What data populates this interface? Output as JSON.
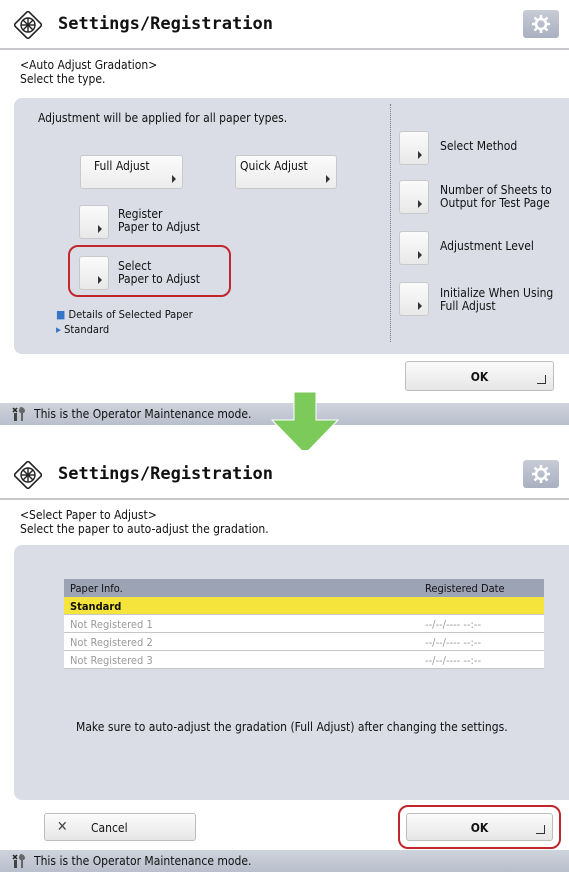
{
  "top": {
    "title": "Settings/Registration",
    "subheading_1": "<Auto Adjust Gradation>",
    "subheading_2": "Select the type.",
    "info": "Adjustment will be applied for all paper types.",
    "full_adjust": "Full Adjust",
    "quick_adjust": "Quick Adjust",
    "register_paper_1": "Register",
    "register_paper_2": "Paper to Adjust",
    "select_paper_1": "Select",
    "select_paper_2": "Paper to Adjust",
    "details_label": "Details of Selected Paper",
    "details_value": "Standard",
    "right_options": [
      {
        "line1": "Select Method",
        "line2": ""
      },
      {
        "line1": "Number of Sheets to",
        "line2": "Output for Test Page"
      },
      {
        "line1": "Adjustment Level",
        "line2": ""
      },
      {
        "line1": "Initialize When Using",
        "line2": "Full Adjust"
      }
    ],
    "ok": "OK",
    "footer": "This is the Operator Maintenance mode."
  },
  "bottom": {
    "title": "Settings/Registration",
    "subheading_1": "<Select Paper to Adjust>",
    "subheading_2": "Select the paper to auto-adjust the gradation.",
    "columns": [
      "Paper Info.",
      "Registered Date"
    ],
    "rows": [
      {
        "name": "Standard",
        "date": ""
      },
      {
        "name": "Not Registered 1",
        "date": "--/--/---- --:--"
      },
      {
        "name": "Not Registered 2",
        "date": "--/--/---- --:--"
      },
      {
        "name": "Not Registered 3",
        "date": "--/--/---- --:--"
      }
    ],
    "note": "Make sure to auto-adjust the gradation (Full Adjust) after changing the settings.",
    "cancel": "Cancel",
    "ok": "OK",
    "footer": "This is the Operator Maintenance mode."
  },
  "colors": {
    "highlight_ring": "#c0262c",
    "selected_row": "#f4e43c",
    "transition_arrow": "#7ccb5a"
  },
  "icons": [
    "settings-registration-icon",
    "gear-icon",
    "wrench-icon",
    "down-arrow-icon",
    "cancel-x-icon"
  ]
}
